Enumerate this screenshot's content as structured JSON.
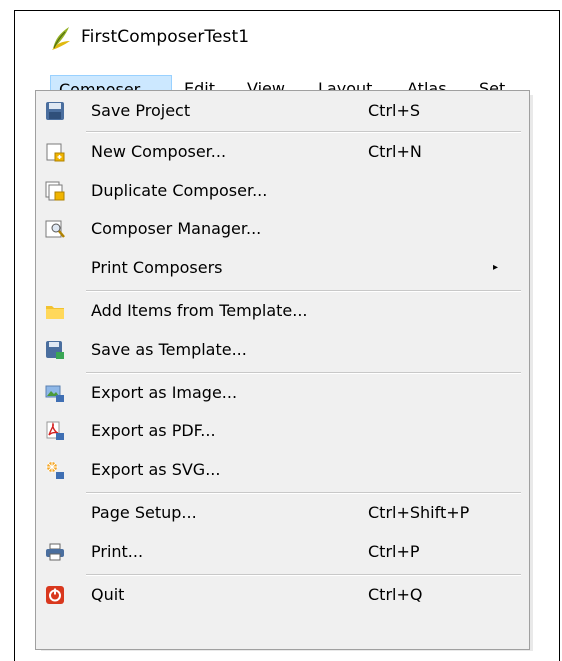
{
  "window": {
    "title": "FirstComposerTest1"
  },
  "menubar": {
    "items": [
      "Composer",
      "Edit",
      "View",
      "Layout",
      "Atlas",
      "Set"
    ],
    "active": "Composer"
  },
  "menu": {
    "items": [
      {
        "label": "Save Project",
        "shortcut": "Ctrl+S",
        "icon": "save-icon"
      },
      {
        "label": "New Composer...",
        "shortcut": "Ctrl+N",
        "icon": "new-composer-icon"
      },
      {
        "label": "Duplicate Composer...",
        "shortcut": "",
        "icon": "duplicate-composer-icon"
      },
      {
        "label": "Composer Manager...",
        "shortcut": "",
        "icon": "composer-manager-icon"
      },
      {
        "label": "Print Composers",
        "shortcut": "",
        "icon": "",
        "submenu": "▸"
      },
      {
        "label": "Add Items from Template...",
        "shortcut": "",
        "icon": "folder-icon"
      },
      {
        "label": "Save as Template...",
        "shortcut": "",
        "icon": "save-template-icon"
      },
      {
        "label": "Export as Image...",
        "shortcut": "",
        "icon": "export-image-icon"
      },
      {
        "label": "Export as PDF...",
        "shortcut": "",
        "icon": "export-pdf-icon"
      },
      {
        "label": "Export as SVG...",
        "shortcut": "",
        "icon": "export-svg-icon"
      },
      {
        "label": "Page Setup...",
        "shortcut": "Ctrl+Shift+P",
        "icon": ""
      },
      {
        "label": "Print...",
        "shortcut": "Ctrl+P",
        "icon": "printer-icon"
      },
      {
        "label": "Quit",
        "shortcut": "Ctrl+Q",
        "icon": "quit-icon"
      }
    ]
  },
  "colors": {
    "menu_bg": "#f0f0f0",
    "menubar_active_bg": "#cce8ff",
    "menubar_active_border": "#99d1ff",
    "separator": "#c8c8c8"
  }
}
